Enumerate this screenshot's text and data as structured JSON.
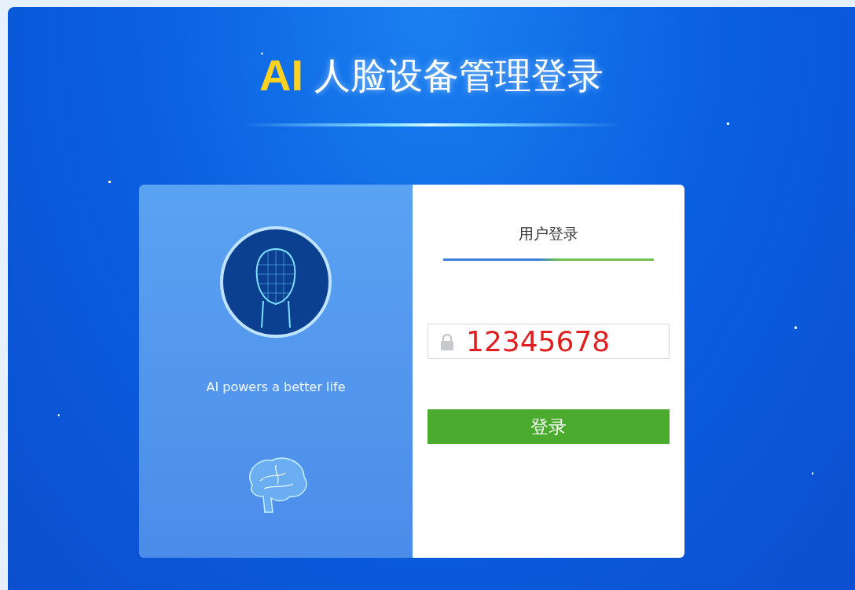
{
  "header": {
    "logo": "AI",
    "title": "人脸设备管理登录"
  },
  "left_panel": {
    "slogan": "AI powers a better life"
  },
  "login": {
    "heading": "用户登录",
    "password_field": {
      "value": "12345678"
    },
    "submit_button": "登录"
  }
}
